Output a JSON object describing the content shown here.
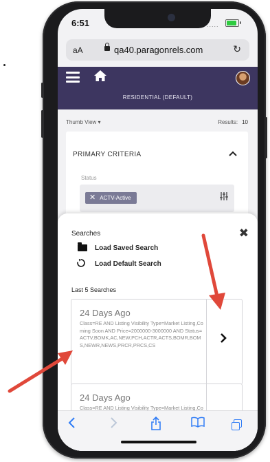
{
  "status_bar": {
    "time": "6:51",
    "signal_dots": "....."
  },
  "browser": {
    "text_size": "aA",
    "url": "qa40.paragonrels.com",
    "reload_glyph": "↻"
  },
  "header": {
    "title": "RESIDENTIAL (DEFAULT)"
  },
  "view_bar": {
    "view_label": "Thumb View ▾",
    "results_label": "Results:",
    "results_count": "10"
  },
  "criteria": {
    "title": "PRIMARY CRITERIA",
    "status_label": "Status",
    "chip_label": "ACTV-Active"
  },
  "searches": {
    "title": "Searches",
    "load_saved": "Load Saved Search",
    "load_default": "Load Default Search",
    "last5_title": "Last 5 Searches",
    "items": [
      {
        "date": "24 Days Ago",
        "text": "Class=RE AND Listing Visibility Type=Market Listing,Coming Soon AND Price=2000000-3000000 AND Status=ACTV,BOMK,AC,NEW,PCH,ACTR,ACTS,BOMR,BOMS,NEWR,NEWS,PRCR,PRCS,CS"
      },
      {
        "date": "24 Days Ago",
        "text": "Class=RE AND Listing Visibility Type=Market Listing,Coming Soon"
      }
    ]
  },
  "colors": {
    "header_bg": "#3d3660",
    "chip_bg": "#7a7a96",
    "annotation_arrow": "#e0483a",
    "safari_blue": "#2f7cf6"
  },
  "icons": [
    "menu-icon",
    "home-icon",
    "avatar",
    "chevron-up-icon",
    "close-icon",
    "sliders-icon",
    "folder-icon",
    "refresh-icon",
    "chevron-right-icon",
    "back-icon",
    "forward-icon",
    "share-icon",
    "bookmarks-icon",
    "tabs-icon"
  ]
}
